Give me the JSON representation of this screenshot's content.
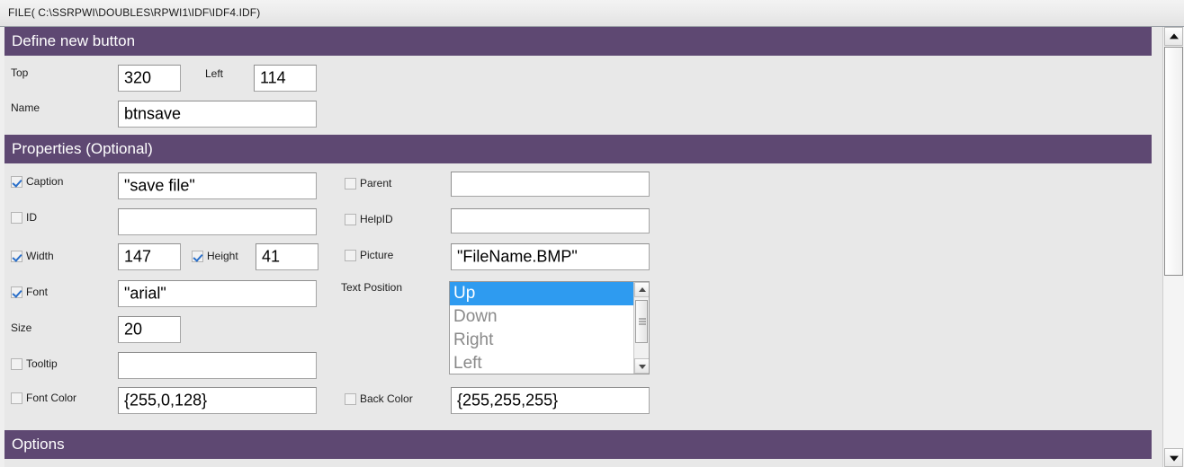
{
  "window": {
    "file_bar_text": "FILE( C:\\SSRPWI\\DOUBLES\\RPWI1\\IDF\\IDF4.IDF)"
  },
  "colors": {
    "header_purple": "#5e4872",
    "background": "#e8e8e8",
    "selection_blue": "#2e9bf0"
  },
  "sections": {
    "define": {
      "title": "Define new button"
    },
    "properties": {
      "title": "Properties (Optional)"
    },
    "options": {
      "title": "Options"
    }
  },
  "define_fields": {
    "top": {
      "label": "Top",
      "value": "320"
    },
    "left": {
      "label": "Left",
      "value": "114"
    },
    "name": {
      "label": "Name",
      "value": "btnsave"
    }
  },
  "properties_left": [
    {
      "label": "Caption",
      "checked": true,
      "value": "\"save file\""
    },
    {
      "label": "ID",
      "checked": false,
      "value": ""
    },
    {
      "label": "Width",
      "checked": true,
      "value": "147"
    },
    {
      "label": "Height",
      "checked": true,
      "value": "41"
    },
    {
      "label": "Font",
      "checked": true,
      "value": "\"arial\""
    },
    {
      "label": "Size",
      "checked": null,
      "value": "20"
    },
    {
      "label": "Tooltip",
      "checked": false,
      "value": ""
    },
    {
      "label": "Font Color",
      "checked": false,
      "value": "{255,0,128}"
    }
  ],
  "properties_right": [
    {
      "label": "Parent",
      "checked": false,
      "value": ""
    },
    {
      "label": "HelpID",
      "checked": false,
      "value": ""
    },
    {
      "label": "Picture",
      "checked": false,
      "value": "\"FileName.BMP\""
    },
    {
      "label": "Back Color",
      "checked": false,
      "value": "{255,255,255}"
    }
  ],
  "text_position": {
    "label": "Text Position",
    "options": [
      "Up",
      "Down",
      "Right",
      "Left"
    ],
    "selected": "Up"
  },
  "icons": {
    "scroll_up": "triangle-up-icon",
    "scroll_down": "triangle-down-icon",
    "checkmark": "check-icon"
  }
}
